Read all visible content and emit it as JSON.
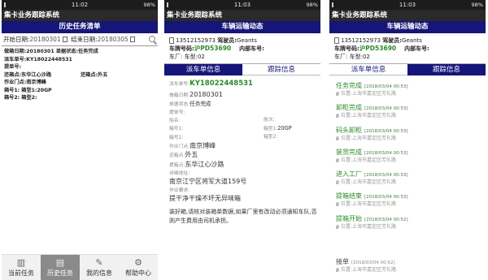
{
  "common": {
    "time": "11:02",
    "time2": "11:03",
    "battery": "98%",
    "app_title": "集卡业务跟踪系统"
  },
  "screen1": {
    "title": "历史任务清单",
    "start_label": "开始日期:",
    "start_value": "20180301",
    "end_label": "结束日期:",
    "end_value": "20180305",
    "card": {
      "line1": "做箱日期:20180301 单据状态:任务完成",
      "line2": "派车单号:KY18022448531",
      "line3": "提单号:",
      "line4_left": "还箱点:东华江心沙路",
      "line4_right": "还箱点:外五",
      "line5": "作业门点:南京博峰",
      "line6": "箱号1:  箱型1:20GP",
      "line7": "箱号2:  箱型2:"
    },
    "nav": [
      {
        "label": "当前任务",
        "icon": "barcode-icon"
      },
      {
        "label": "历史任务",
        "icon": "briefcase-icon"
      },
      {
        "label": "我的信息",
        "icon": "wrench-icon"
      },
      {
        "label": "帮助中心",
        "icon": "gear-icon"
      }
    ]
  },
  "screen2": {
    "title": "车辆运输动态",
    "phone": "13512152973",
    "driver_label": "驾驶员:",
    "driver": "Geants",
    "plate_label": "车牌号码:",
    "plate": "沪PD53690",
    "inner_label": "内部车号:",
    "brand_label": "车厂:",
    "model_label": "车型:",
    "model": "02",
    "tab_dispatch": "派车单信息",
    "tab_track": "跟踪信息",
    "order_label": "派车单号:",
    "order_no": "KY18022448531",
    "box_date_label": "做箱日期:",
    "box_date": "20180301",
    "status_label": "单据状态:",
    "status": "任务完成",
    "bl_label": "提单号:",
    "ship_label": "船名:",
    "voyage_label": "航次:",
    "box1_label": "箱号1:",
    "type1_label": "箱型1:",
    "type1": "20GP",
    "box2_label": "箱号2:",
    "type2_label": "箱型2:",
    "site_label": "作业门点:",
    "site": "南京博峰",
    "return_label": "还箱点:",
    "return": "外五",
    "pickup_label": "提箱点:",
    "pickup": "东华江心沙路",
    "addr_label": "详细地址:",
    "addr": "南京江宁区将军大道159号",
    "req_label": "作业要求:",
    "req": "提干净干燥不坏无异味箱",
    "note": "装好箱,请核对装箱单数据,如果厂里有改动必须通知车队,否则产生费用由司机承担。"
  },
  "screen3": {
    "title": "车辆运输动态",
    "phone": "13512152973",
    "driver_label": "驾驶员:",
    "driver": "Geants",
    "plate_label": "车牌号码:",
    "plate": "沪PD53690",
    "inner_label": "内部车号:",
    "brand_label": "车厂:",
    "model_label": "车型:",
    "model": "02",
    "tab_dispatch": "派车单信息",
    "tab_track": "跟踪信息",
    "events": [
      {
        "status": "任务完成",
        "time": "[2018/03/04 00:53]",
        "loc": "位置:上海市嘉定区芳礼路"
      },
      {
        "status": "卸柜完成",
        "time": "[2018/03/04 00:53]",
        "loc": "位置:上海市嘉定区芳礼路"
      },
      {
        "status": "码头卸柜",
        "time": "[2018/03/04 00:53]",
        "loc": "位置:上海市嘉定区芳礼路"
      },
      {
        "status": "装货完成",
        "time": "[2018/03/04 00:53]",
        "loc": "位置:上海市嘉定区芳礼路"
      },
      {
        "status": "进入工厂",
        "time": "[2018/03/04 00:53]",
        "loc": "位置:上海市嘉定区芳礼路"
      },
      {
        "status": "提箱结束",
        "time": "[2018/03/04 00:53]",
        "loc": "位置:上海市嘉定区芳礼路"
      },
      {
        "status": "提箱开始",
        "time": "[2018/03/04 00:52]",
        "loc": "位置:上海市嘉定区芳礼路"
      }
    ],
    "last_event": {
      "status": "接单",
      "time": "[2018/03/04 00:52]",
      "loc": "位置:上海市嘉定区芳礼路"
    }
  }
}
